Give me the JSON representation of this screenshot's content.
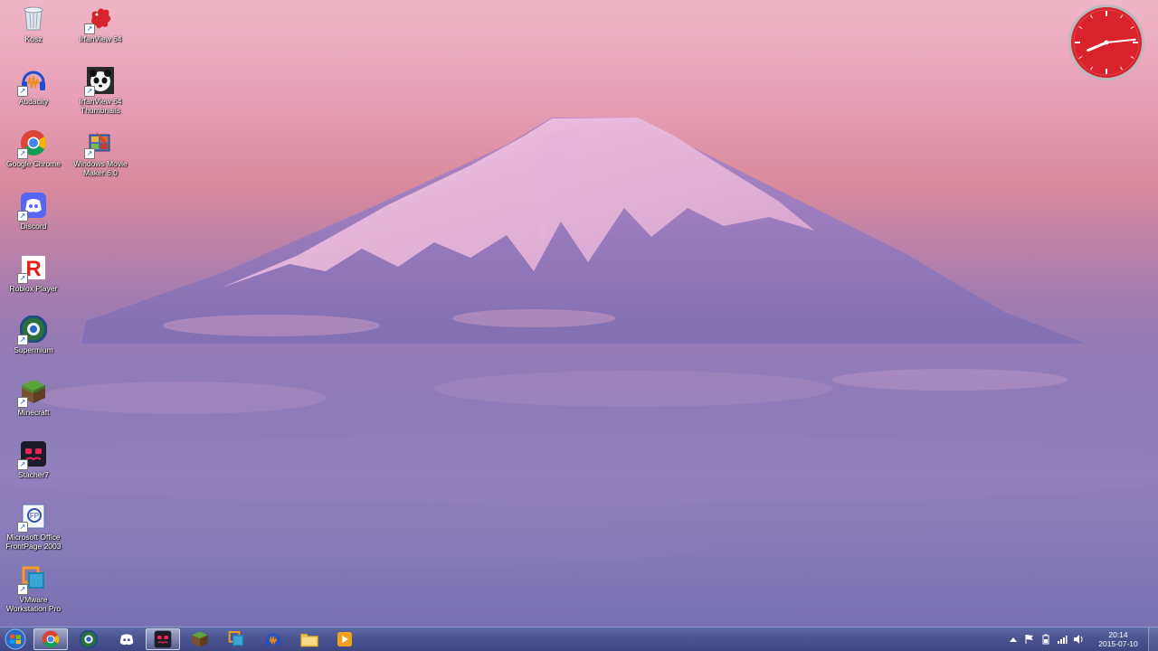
{
  "desktop": {
    "icons": [
      {
        "name": "recycle-bin",
        "label": "Kosz",
        "shortcut": false
      },
      {
        "name": "audacity",
        "label": "Audacity",
        "shortcut": true
      },
      {
        "name": "google-chrome",
        "label": "Google Chrome",
        "shortcut": true
      },
      {
        "name": "discord",
        "label": "Discord",
        "shortcut": true
      },
      {
        "name": "roblox-player",
        "label": "Roblox Player",
        "shortcut": true
      },
      {
        "name": "supermium",
        "label": "Supermium",
        "shortcut": true
      },
      {
        "name": "minecraft",
        "label": "Minecraft",
        "shortcut": true
      },
      {
        "name": "stacher7",
        "label": "Stacher7",
        "shortcut": true
      },
      {
        "name": "ms-frontpage",
        "label": "Microsoft Office\nFrontPage 2003",
        "shortcut": true
      },
      {
        "name": "vmware",
        "label": "VMware\nWorkstation Pro",
        "shortcut": true
      },
      {
        "name": "irfanview",
        "label": "IrfanView 64",
        "shortcut": true
      },
      {
        "name": "irfanview-thumbnails",
        "label": "IrfanView 64\nThumbnails",
        "shortcut": true
      },
      {
        "name": "movie-maker",
        "label": "Windows Movie\nMaker 6.0",
        "shortcut": true
      }
    ]
  },
  "gadget": {
    "clock": {
      "hour": 20,
      "minute": 14,
      "face_color": "#d8222c"
    }
  },
  "taskbar": {
    "start_label": "Start",
    "pinned": [
      {
        "name": "chrome",
        "active": true
      },
      {
        "name": "supermium",
        "active": false
      },
      {
        "name": "discord",
        "active": false
      },
      {
        "name": "stacher7",
        "active": true
      },
      {
        "name": "minecraft",
        "active": false
      },
      {
        "name": "vmware",
        "active": false
      },
      {
        "name": "audacity",
        "active": false
      },
      {
        "name": "file-explorer",
        "active": false
      },
      {
        "name": "media-player",
        "active": false
      }
    ],
    "tray": {
      "icons": [
        "show-hidden-icons",
        "action-center-flag-icon",
        "power-icon",
        "network-signal-icon",
        "volume-icon"
      ],
      "time": "20:14",
      "date": "2015-07-10"
    }
  }
}
